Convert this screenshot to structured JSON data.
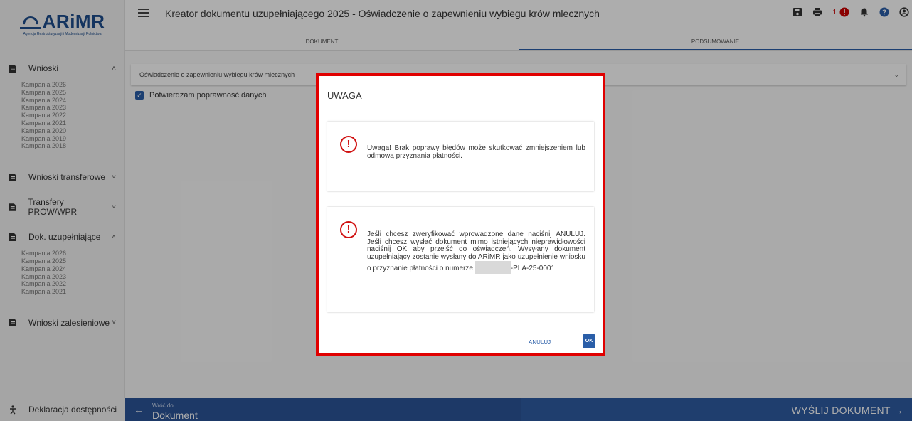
{
  "logo": {
    "text": "ARiMR",
    "subtitle": "Agencja Restrukturyzacji i Modernizacji Rolnictwa"
  },
  "sidebar": {
    "groups": [
      {
        "label": "Wnioski",
        "expanded": true,
        "items": [
          "Kampania 2026",
          "Kampania 2025",
          "Kampania 2024",
          "Kampania 2023",
          "Kampania 2022",
          "Kampania 2021",
          "Kampania 2020",
          "Kampania 2019",
          "Kampania 2018"
        ]
      },
      {
        "label": "Wnioski transferowe",
        "expanded": false,
        "items": []
      },
      {
        "label": "Transfery PROW/WPR",
        "expanded": false,
        "items": []
      },
      {
        "label": "Dok. uzupełniające",
        "expanded": true,
        "items": [
          "Kampania 2026",
          "Kampania 2025",
          "Kampania 2024",
          "Kampania 2023",
          "Kampania 2022",
          "Kampania 2021"
        ]
      },
      {
        "label": "Wnioski zalesieniowe",
        "expanded": false,
        "items": []
      }
    ],
    "footer": "Deklaracja dostępności"
  },
  "header": {
    "title": "Kreator dokumentu uzupełniającego 2025 - Oświadczenie o zapewnieniu wybiegu krów mlecznych",
    "alert_count": "1",
    "tabs": [
      "DOKUMENT",
      "PODSUMOWANIE"
    ],
    "active_tab": 1
  },
  "main": {
    "accordion_title": "Oświadczenie o zapewnieniu wybiegu krów mlecznych",
    "confirm_label": "Potwierdzam poprawność danych",
    "confirm_checked": true
  },
  "bottom": {
    "back_small": "Wróć do",
    "back_big": "Dokument",
    "send": "WYŚLIJ DOKUMENT"
  },
  "dialog": {
    "title": "UWAGA",
    "message1": "Uwaga! Brak poprawy błędów może skutkować zmniejszeniem lub odmową przyznania płatności.",
    "message2_part1": "Jeśli chcesz zweryfikować wprowadzone dane naciśnij ANULUJ. Jeśli chcesz wysłać dokument mimo istniejących nieprawidłowości naciśnij OK aby przejść do oświadczeń. Wysyłany dokument uzupełniający zostanie wysłany do ARiMR jako uzupełnienie wniosku o przyznanie płatności o numerze",
    "message2_part2": "-PLA-25-0001",
    "cancel_label": "ANULUJ",
    "ok_label": "OK"
  },
  "colors": {
    "primary": "#2a5ea8",
    "bottombar": "#2b5599",
    "alert_red": "#d01010",
    "highlight_border": "#e00000"
  }
}
